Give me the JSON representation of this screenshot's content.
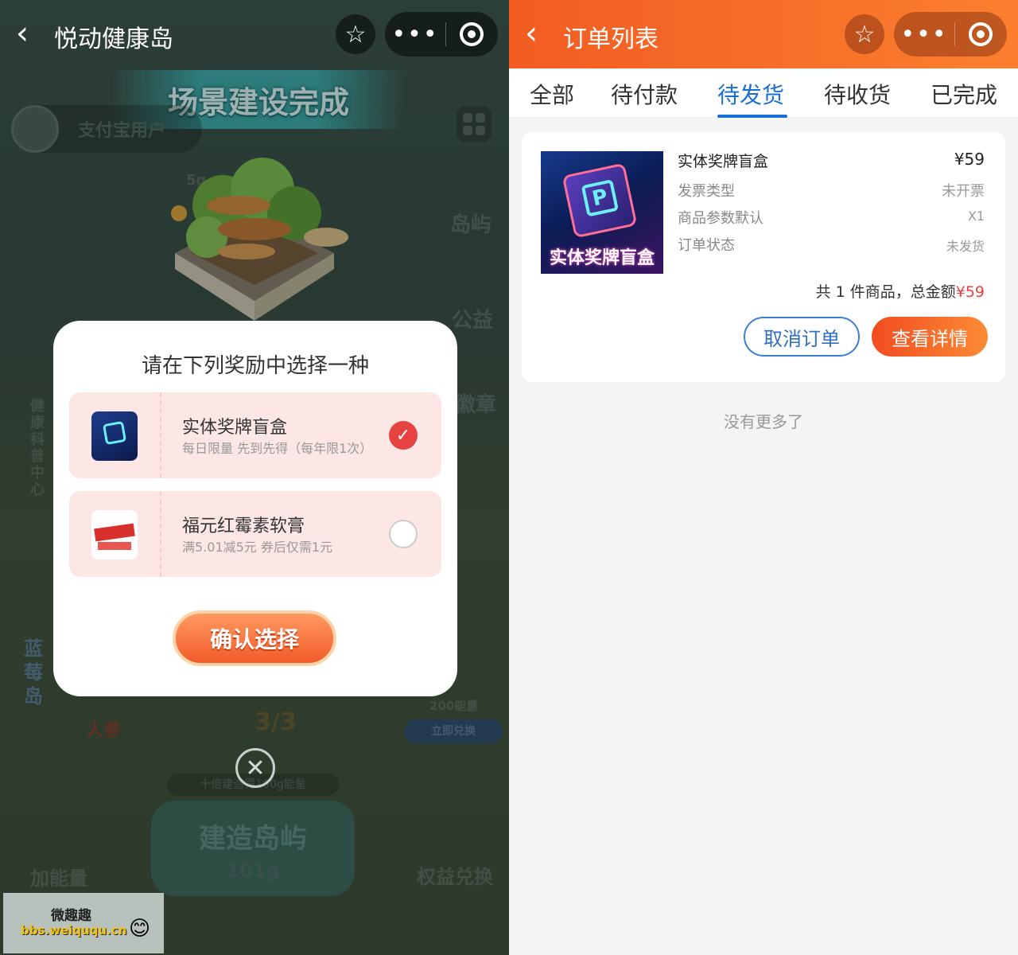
{
  "left": {
    "title": "悦动健康岛",
    "banner": "场景建设完成",
    "user_name": "支付宝用户",
    "island_weight": "5g",
    "side_labels": [
      "岛屿",
      "公益",
      "徽章"
    ],
    "vertical_label": "健康科普中心",
    "blue_island": "蓝莓岛",
    "ginseng": "人参",
    "progress": "3/3",
    "energy_need": "200能量",
    "redeem": "立即兑换",
    "ten_times": "十倍建造得100g能量",
    "build_label": "建造岛屿",
    "build_amount": "101g",
    "add_energy": "加能量",
    "rights_exchange": "权益兑换",
    "modal": {
      "title": "请在下列奖励中选择一种",
      "options": [
        {
          "name": "实体奖牌盲盒",
          "desc": "每日限量 先到先得（每年限1次）",
          "selected": true
        },
        {
          "name": "福元红霉素软膏",
          "desc": "满5.01减5元 券后仅需1元",
          "selected": false
        }
      ],
      "confirm": "确认选择"
    },
    "watermark": {
      "title": "微趣趣",
      "url": "bbs.weiququ.cn"
    }
  },
  "right": {
    "title": "订单列表",
    "tabs": [
      "全部",
      "待付款",
      "待发货",
      "待收货",
      "已完成"
    ],
    "active_tab": "待发货",
    "order": {
      "image_text": "实体奖牌盲盒",
      "name": "实体奖牌盲盒",
      "price": "¥59",
      "rows": [
        {
          "label": "发票类型",
          "value": "未开票"
        },
        {
          "label": "商品参数默认",
          "value": "X1"
        },
        {
          "label": "订单状态",
          "value": "未发货"
        }
      ],
      "total_prefix": "共 1 件商品，总金额",
      "total_amount": "¥59",
      "cancel": "取消订单",
      "detail": "查看详情"
    },
    "no_more": "没有更多了"
  },
  "colors": {
    "accent_blue": "#1a6fd6",
    "accent_red": "#e64340",
    "header_orange": "#f25c22"
  }
}
